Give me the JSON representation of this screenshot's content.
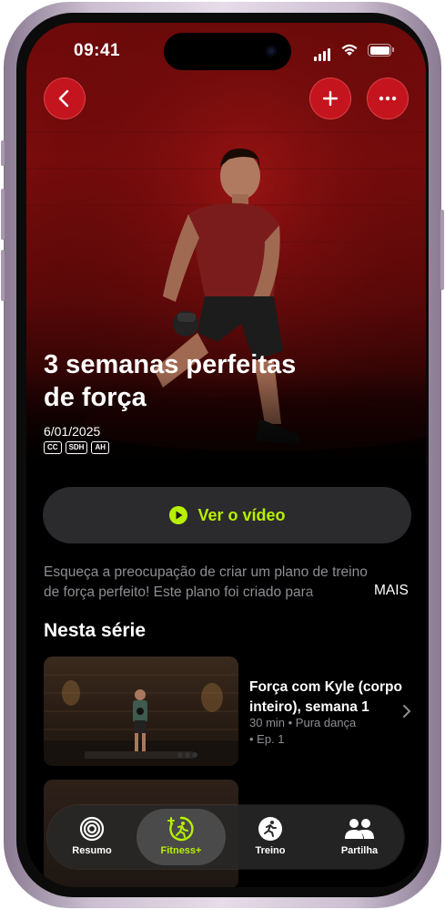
{
  "status": {
    "time": "09:41"
  },
  "nav": {
    "back_icon": "chevron-left-icon",
    "add_icon": "plus-icon",
    "more_icon": "ellipsis-icon"
  },
  "hero": {
    "title_line1": "3 semanas perfeitas",
    "title_line2": "de força",
    "date": "6/01/2025",
    "badges": [
      "CC",
      "SDH",
      "AH"
    ]
  },
  "play_button": {
    "label": "Ver o vídeo",
    "icon": "play-circle-icon"
  },
  "description": {
    "line1": "Esqueça a preocupação de criar um plano de treino",
    "line2": "de força perfeito! Este plano foi criado para",
    "more": "MAIS"
  },
  "series": {
    "heading": "Nesta série",
    "episodes": [
      {
        "title_line1": "Força com Kyle (corpo",
        "title_line2": "inteiro), semana 1",
        "meta_line1": "30 min • Pura dança",
        "meta_line2": "• Ep. 1"
      }
    ]
  },
  "tabbar": {
    "tabs": [
      {
        "label": "Resumo",
        "icon": "activity-rings-icon"
      },
      {
        "label": "Fitness+",
        "icon": "fitness-plus-icon",
        "active": true
      },
      {
        "label": "Treino",
        "icon": "running-figure-icon"
      },
      {
        "label": "Partilha",
        "icon": "people-icon"
      }
    ]
  },
  "colors": {
    "accent": "#B7F000",
    "hero_red": "#7A0C0C",
    "button_red": "#C4141E"
  }
}
